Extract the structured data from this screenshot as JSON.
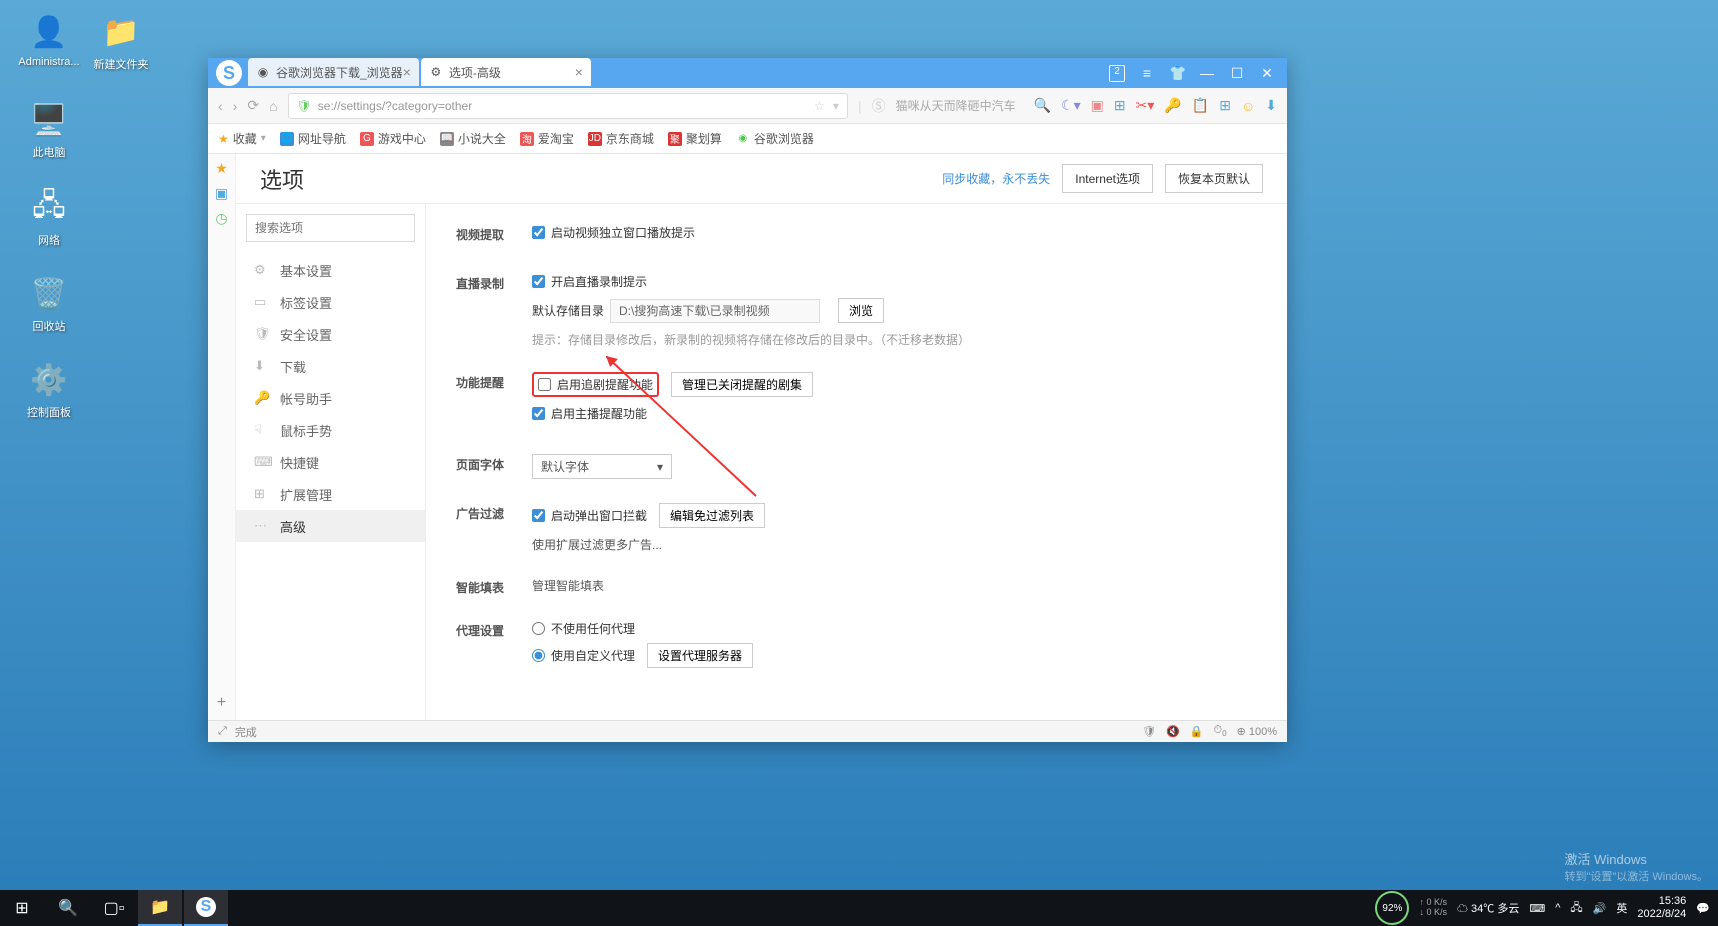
{
  "desktop": {
    "icons": [
      {
        "label": "Administra...",
        "emoji": "👤"
      },
      {
        "label": "新建文件夹",
        "emoji": "📁"
      },
      {
        "label": "此电脑",
        "emoji": "🖥️"
      },
      {
        "label": "网络",
        "emoji": "🖧"
      },
      {
        "label": "回收站",
        "emoji": "🗑️"
      },
      {
        "label": "控制面板",
        "emoji": "⚙️"
      }
    ]
  },
  "browser": {
    "tabs": [
      {
        "title": "谷歌浏览器下载_浏览器",
        "active": false
      },
      {
        "title": "选项-高级",
        "active": true
      }
    ],
    "window_badge": "2",
    "url": "se://settings/?category=other",
    "search_hint": "猫咪从天而降砸中汽车",
    "bookmarks_label": "收藏",
    "bookmarks": [
      {
        "label": "网址导航",
        "color": "#3b8fd6"
      },
      {
        "label": "游戏中心",
        "color": "#e55"
      },
      {
        "label": "小说大全",
        "color": "#888"
      },
      {
        "label": "爱淘宝",
        "color": "#e55"
      },
      {
        "label": "京东商城",
        "color": "#d33",
        "badge": "JD"
      },
      {
        "label": "聚划算",
        "color": "#d33",
        "badge": "聚"
      },
      {
        "label": "谷歌浏览器",
        "color": "#4c4"
      }
    ]
  },
  "settings": {
    "title": "选项",
    "sync_link": "同步收藏，永不丢失",
    "internet_btn": "Internet选项",
    "restore_btn": "恢复本页默认",
    "search_placeholder": "搜索选项",
    "nav": [
      {
        "label": "基本设置",
        "icon": "⚙"
      },
      {
        "label": "标签设置",
        "icon": "▭"
      },
      {
        "label": "安全设置",
        "icon": "🛡"
      },
      {
        "label": "下载",
        "icon": "⬇"
      },
      {
        "label": "帐号助手",
        "icon": "🔑"
      },
      {
        "label": "鼠标手势",
        "icon": "☟"
      },
      {
        "label": "快捷键",
        "icon": "⌨"
      },
      {
        "label": "扩展管理",
        "icon": "⊞"
      },
      {
        "label": "高级",
        "icon": "⋯",
        "active": true
      }
    ],
    "sections": {
      "video_extract": {
        "label": "视频提取",
        "cb1": "启动视频独立窗口播放提示"
      },
      "live_record": {
        "label": "直播录制",
        "cb1": "开启直播录制提示",
        "path_label": "默认存储目录",
        "path_value": "D:\\搜狗高速下载\\已录制视频",
        "browse": "浏览",
        "hint": "提示：存储目录修改后，新录制的视频将存储在修改后的目录中。（不迁移老数据）"
      },
      "feature_remind": {
        "label": "功能提醒",
        "cb1": "启用追剧提醒功能",
        "btn1": "管理已关闭提醒的剧集",
        "cb2": "启用主播提醒功能"
      },
      "page_font": {
        "label": "页面字体",
        "value": "默认字体"
      },
      "ad_filter": {
        "label": "广告过滤",
        "cb1": "启动弹出窗口拦截",
        "btn1": "编辑免过滤列表",
        "link": "使用扩展过滤更多广告..."
      },
      "smart_fill": {
        "label": "智能填表",
        "link": "管理智能填表"
      },
      "proxy": {
        "label": "代理设置",
        "r1": "不使用任何代理",
        "r2": "使用自定义代理",
        "btn": "设置代理服务器"
      }
    },
    "status_text": "完成",
    "zoom": "100%"
  },
  "taskbar": {
    "weather": "34℃ 多云",
    "battery": "92%",
    "net_up": "0 K/s",
    "net_down": "0 K/s",
    "ime": "英",
    "time": "15:36",
    "date": "2022/8/24"
  },
  "watermark": {
    "line1": "激活 Windows",
    "line2": "转到\"设置\"以激活 Windows。"
  }
}
